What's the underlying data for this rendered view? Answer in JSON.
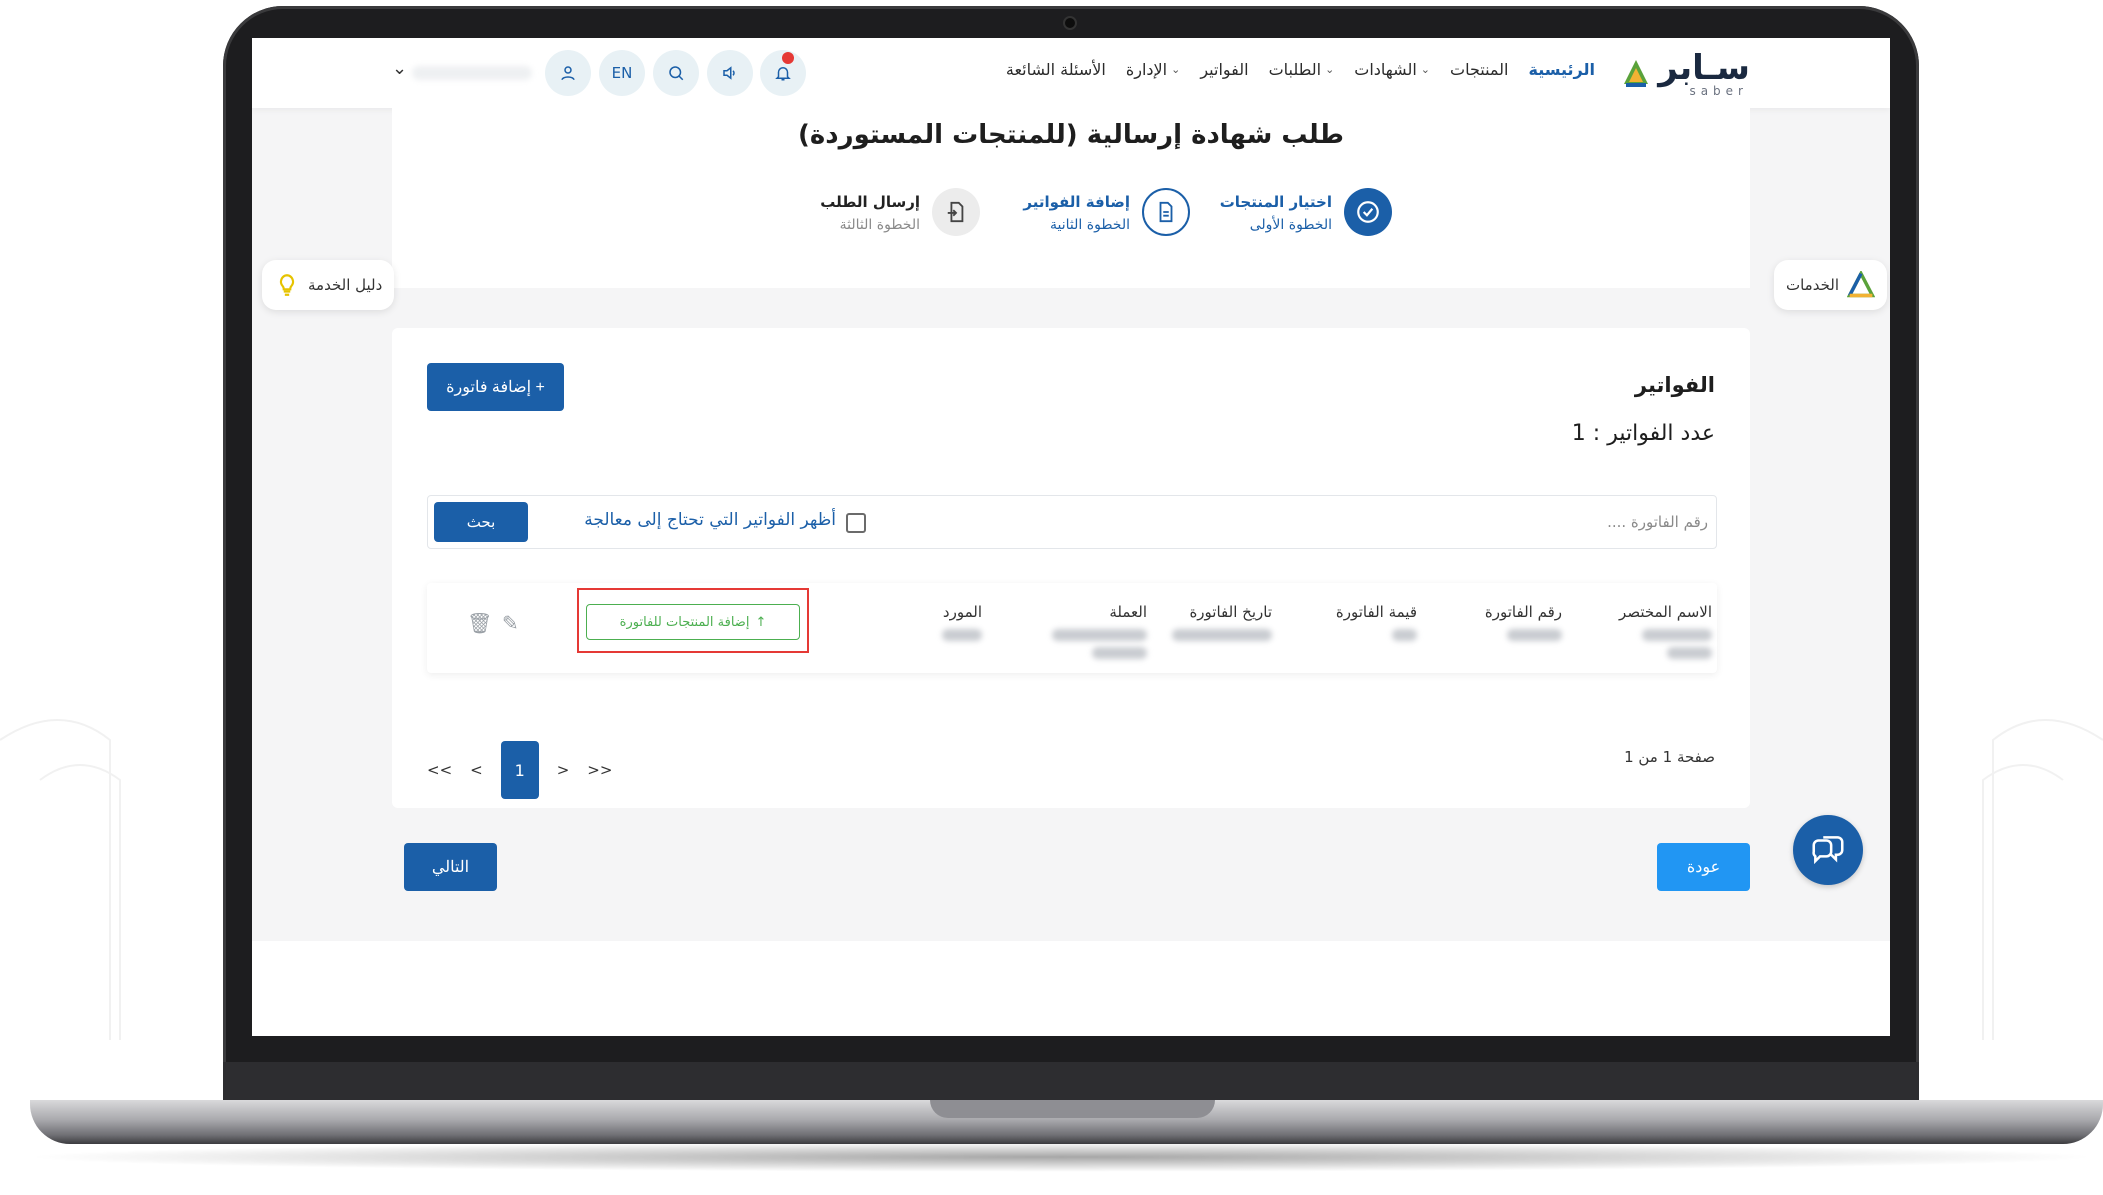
{
  "header": {
    "logo_text": "سـابر",
    "logo_sub": "saber",
    "nav": [
      {
        "label": "الرئيسية",
        "active": true,
        "dropdown": false
      },
      {
        "label": "المنتجات",
        "active": false,
        "dropdown": false
      },
      {
        "label": "الشهادات",
        "active": false,
        "dropdown": true
      },
      {
        "label": "الطلبات",
        "active": false,
        "dropdown": true
      },
      {
        "label": "الفواتير",
        "active": false,
        "dropdown": false
      },
      {
        "label": "الإدارة",
        "active": false,
        "dropdown": true
      },
      {
        "label": "الأسئلة الشائعة",
        "active": false,
        "dropdown": false
      }
    ],
    "lang_label": "EN"
  },
  "page": {
    "title": "طلب شهادة إرسالية (للمنتجات المستوردة)",
    "steps": [
      {
        "title": "اختيار المنتجات",
        "subtitle": "الخطوة الأولى",
        "state": "done"
      },
      {
        "title": "إضافة الفواتير",
        "subtitle": "الخطوة الثانية",
        "state": "current"
      },
      {
        "title": "إرسال الطلب",
        "subtitle": "الخطوة الثالثة",
        "state": "pending"
      }
    ]
  },
  "side": {
    "services_label": "الخدمات",
    "guide_label": "دليل الخدمة"
  },
  "invoices": {
    "section_title": "الفواتير",
    "count_label": "عدد الفواتير :",
    "count_value": "1",
    "add_button": "إضافة فاتورة +",
    "search_placeholder": "رقم الفاتورة ....",
    "checkbox_label": "أظهر الفواتير التي تحتاج إلى معالجة",
    "search_button": "بحث",
    "columns": [
      "الاسم المختصر",
      "رقم الفاتورة",
      "قيمة الفاتورة",
      "تاريخ الفاتورة",
      "العملة",
      "المورد"
    ],
    "add_products_button": "إضافة المنتجات للفاتورة",
    "pagination": {
      "first": "<<",
      "prev": "<",
      "current": "1",
      "next": ">",
      "last": ">>"
    },
    "page_info": "صفحة 1 من 1"
  },
  "footer": {
    "next_button": "التالي",
    "back_button": "عودة"
  },
  "colors": {
    "primary": "#1b5fa8",
    "secondary": "#2196f3",
    "success": "#4caf50",
    "highlight": "#e53935"
  }
}
